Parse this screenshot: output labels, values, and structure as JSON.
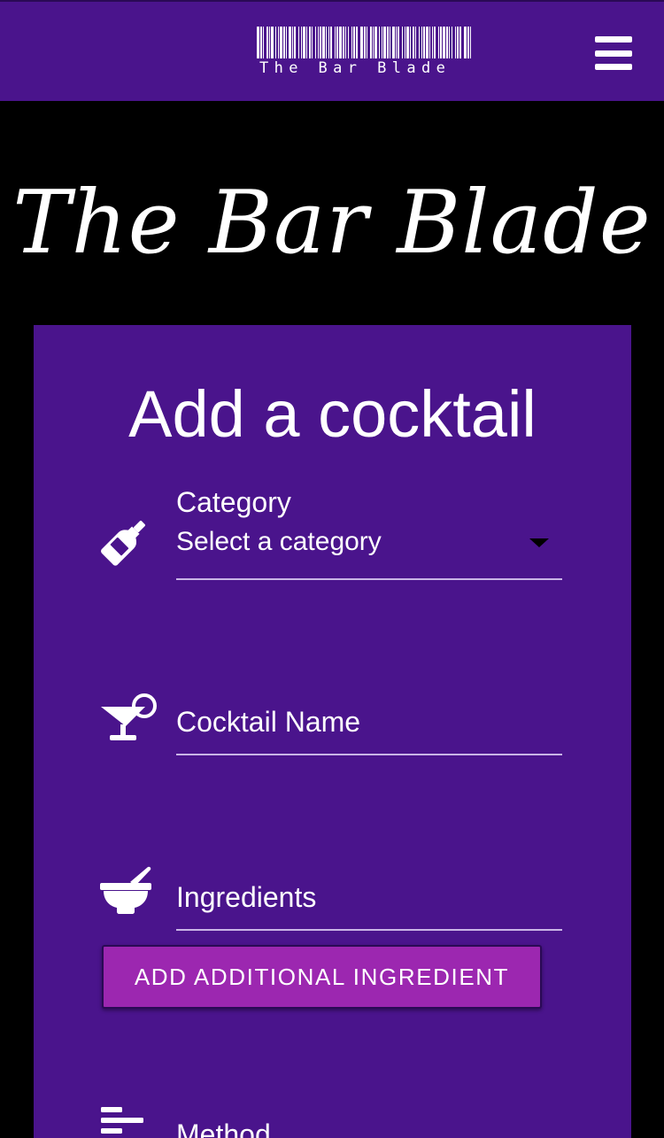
{
  "navbar": {
    "logo_text": "The Bar Blade",
    "menu_icon": "hamburger-menu-icon"
  },
  "hero": {
    "title": "The Bar Blade"
  },
  "form": {
    "title": "Add a cocktail",
    "category": {
      "label": "Category",
      "value": "Select a category",
      "icon": "wine-bottle-icon"
    },
    "cocktail_name": {
      "placeholder": "Cocktail Name",
      "icon": "cocktail-glass-icon"
    },
    "ingredients": {
      "placeholder": "Ingredients",
      "icon": "mortar-pestle-icon"
    },
    "add_ingredient_button": "ADD ADDITIONAL INGREDIENT",
    "method": {
      "placeholder": "Method",
      "icon": "align-left-icon"
    }
  },
  "colors": {
    "primary": "#4a148c",
    "accent": "#9c27b0",
    "background": "#000000"
  }
}
